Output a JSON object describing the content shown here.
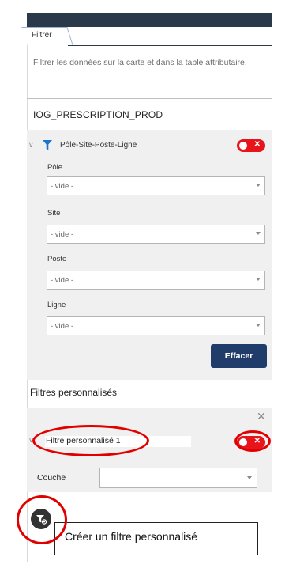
{
  "tabs": [
    {
      "label": "Filtrer"
    }
  ],
  "description": "Filtrer les données sur la carte et dans la table attributaire.",
  "layer": {
    "title": "IOG_PRESCRIPTION_PROD"
  },
  "group_filter": {
    "name": "Pôle-Site-Poste-Ligne",
    "enabled": false,
    "fields": [
      {
        "label": "Pôle",
        "value": "- vide -"
      },
      {
        "label": "Site",
        "value": "- vide -"
      },
      {
        "label": "Poste",
        "value": "- vide -"
      },
      {
        "label": "Ligne",
        "value": "- vide -"
      }
    ],
    "clear_button": "Effacer"
  },
  "custom_filters": {
    "title": "Filtres personnalisés",
    "items": [
      {
        "name": "Filtre personnalisé 1",
        "enabled": false,
        "couche_label": "Couche",
        "couche_value": ""
      }
    ]
  },
  "fab": {
    "icon": "filter-add-icon"
  },
  "tooltip": {
    "text": "Créer un filtre personnalisé"
  },
  "colors": {
    "accent": "#1f3c6b",
    "toggle_off": "#e8141c",
    "header": "#2b3a4a",
    "annotation": "#e00000"
  }
}
